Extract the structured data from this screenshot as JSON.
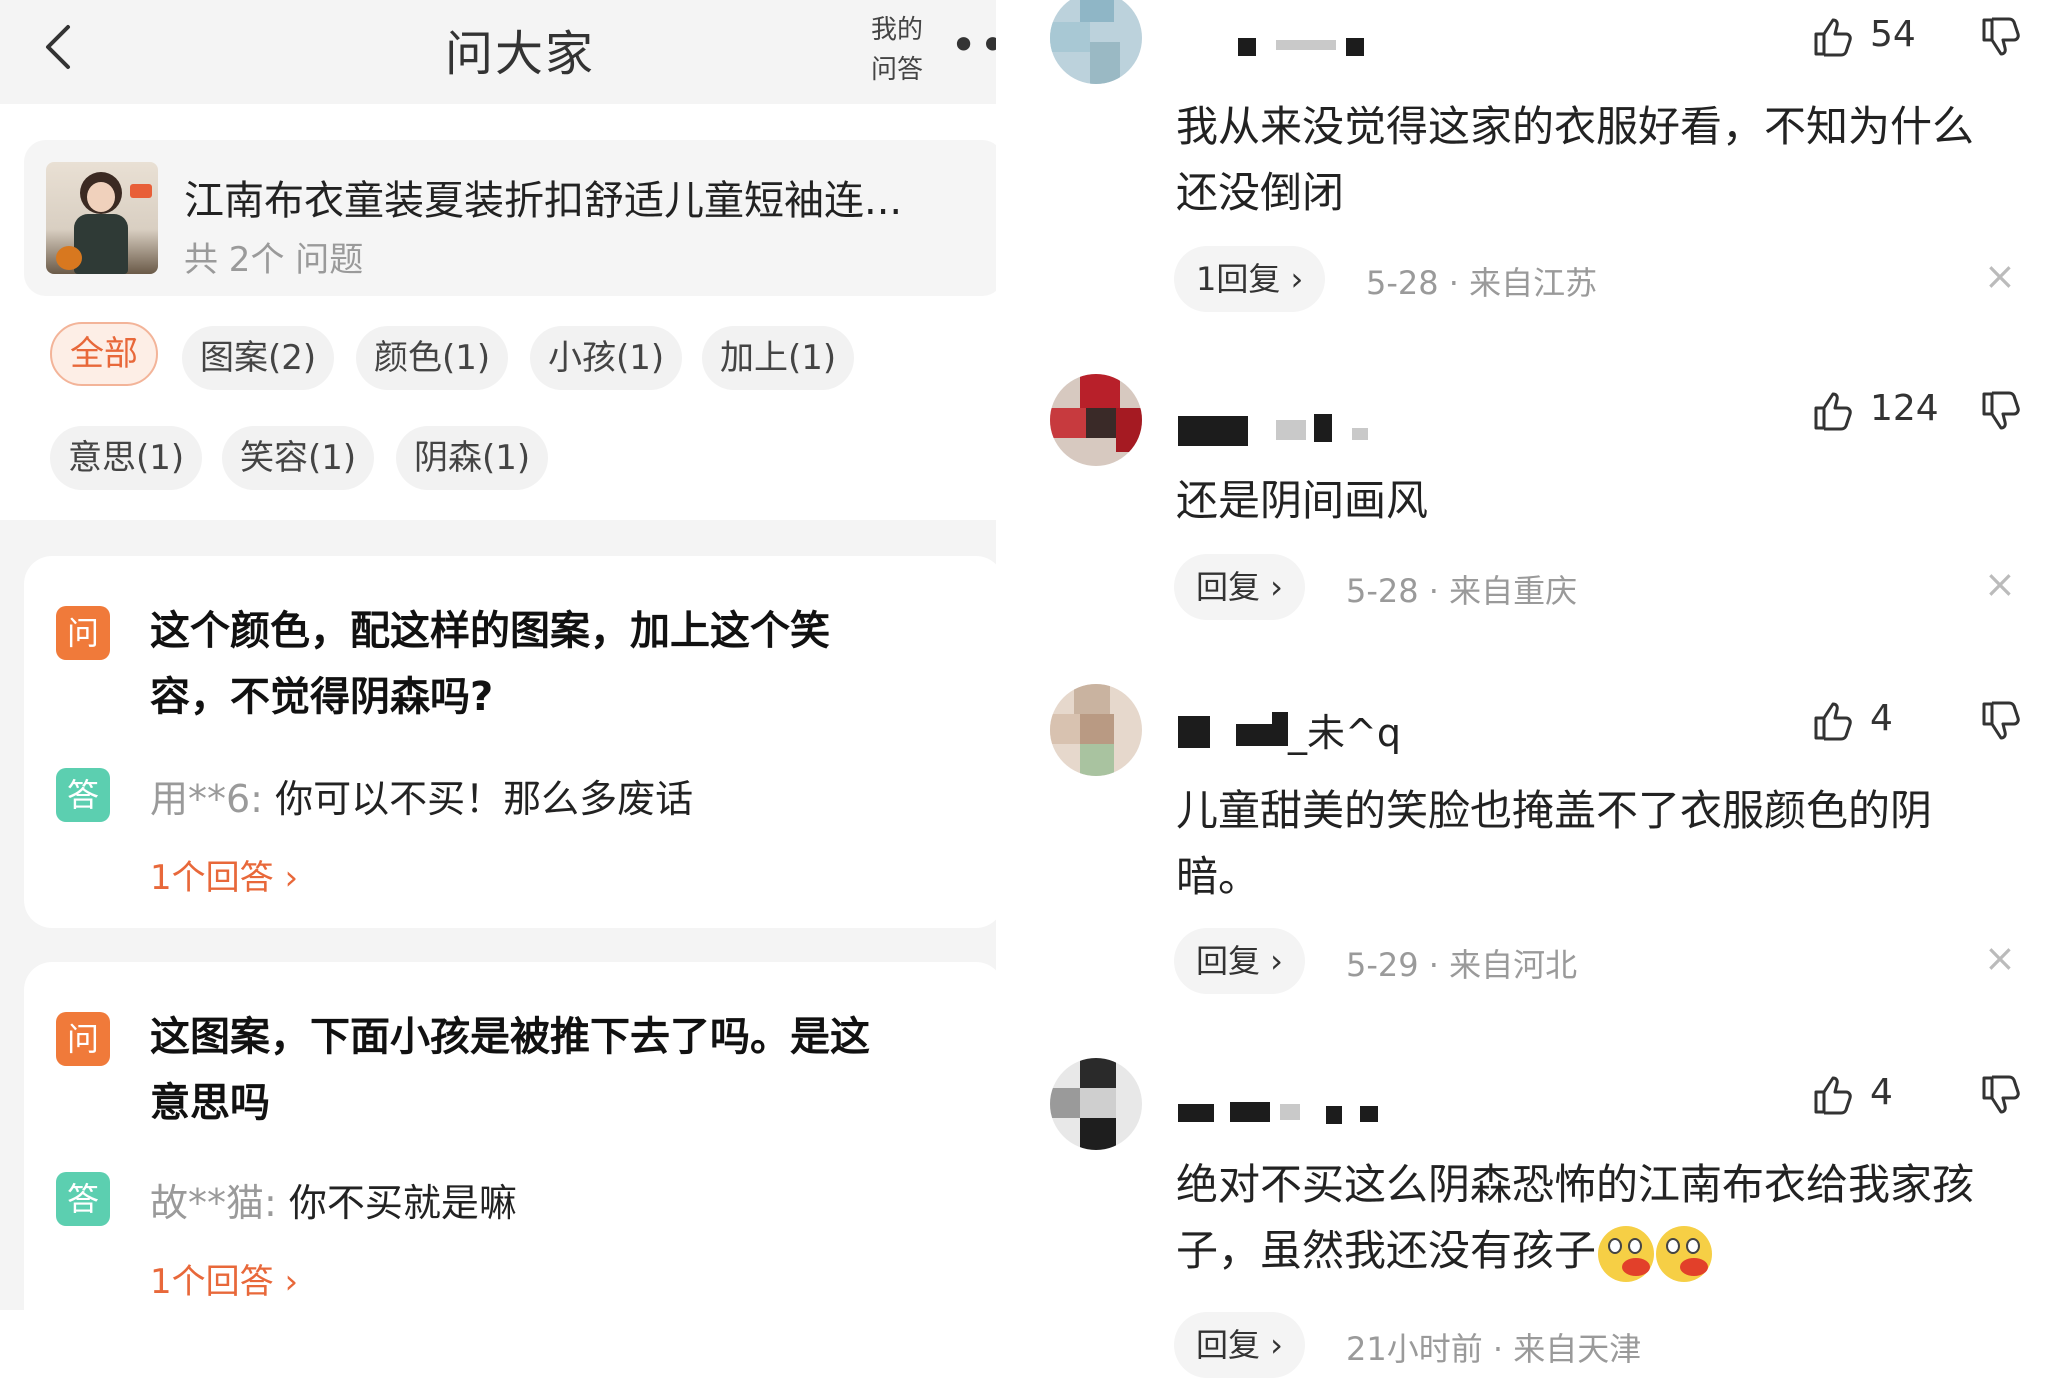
{
  "left": {
    "nav": {
      "title": "问大家",
      "my_questions_line1": "我的",
      "my_questions_line2": "问答",
      "more": "•••"
    },
    "product": {
      "title": "江南布衣童装夏装折扣舒适儿童短袖连...",
      "count": "共 2个 问题"
    },
    "filters": [
      {
        "label": "全部",
        "active": true
      },
      {
        "label": "图案(2)",
        "active": false
      },
      {
        "label": "颜色(1)",
        "active": false
      },
      {
        "label": "小孩(1)",
        "active": false
      },
      {
        "label": "加上(1)",
        "active": false
      },
      {
        "label": "意思(1)",
        "active": false
      },
      {
        "label": "笑容(1)",
        "active": false
      },
      {
        "label": "阴森(1)",
        "active": false
      }
    ],
    "questions": [
      {
        "q_badge": "问",
        "question_line1": "这个颜色，配这样的图案，加上这个笑",
        "question_line2": "容，不觉得阴森吗?",
        "a_badge": "答",
        "answer_user": "用**6:",
        "answer_text": "你可以不买！那么多废话",
        "answers_link": "1个回答 ›"
      },
      {
        "q_badge": "问",
        "question_line1": "这图案，下面小孩是被推下去了吗。是这",
        "question_line2": "意思吗",
        "a_badge": "答",
        "answer_user": "故**猫:",
        "answer_text": "你不买就是嘛",
        "answers_link": "1个回答 ›"
      }
    ]
  },
  "comments": [
    {
      "likes": "54",
      "text_line1": "我从来没觉得这家的衣服好看，不知为什么",
      "text_line2": "还没倒闭",
      "reply": "1回复 ›",
      "meta": "5-28 · 来自江苏",
      "close": "×"
    },
    {
      "likes": "124",
      "text_line1": "还是阴间画风",
      "text_line2": "",
      "reply": "回复 ›",
      "meta": "5-28 · 来自重庆",
      "close": "×"
    },
    {
      "username_tail": "_未^q",
      "likes": "4",
      "text_line1": "儿童甜美的笑脸也掩盖不了衣服颜色的阴",
      "text_line2": "暗。",
      "reply": "回复 ›",
      "meta": "5-29 · 来自河北",
      "close": "×"
    },
    {
      "likes": "4",
      "text_line1": "绝对不买这么阴森恐怖的江南布衣给我家孩",
      "text_line2": "子，虽然我还没有孩子",
      "reply": "回复 ›",
      "meta": "21小时前 · 来自天津"
    }
  ],
  "icons": {
    "back": "chevron-left-icon",
    "like": "thumbs-up-icon",
    "dislike": "thumbs-down-icon",
    "close": "close-icon",
    "emoji": "drooling-face-emoji"
  },
  "colors": {
    "accent_orange": "#e8683a",
    "question_badge": "#f07a3a",
    "answer_badge": "#5ccfb0",
    "muted_text": "#9a9a9a"
  }
}
